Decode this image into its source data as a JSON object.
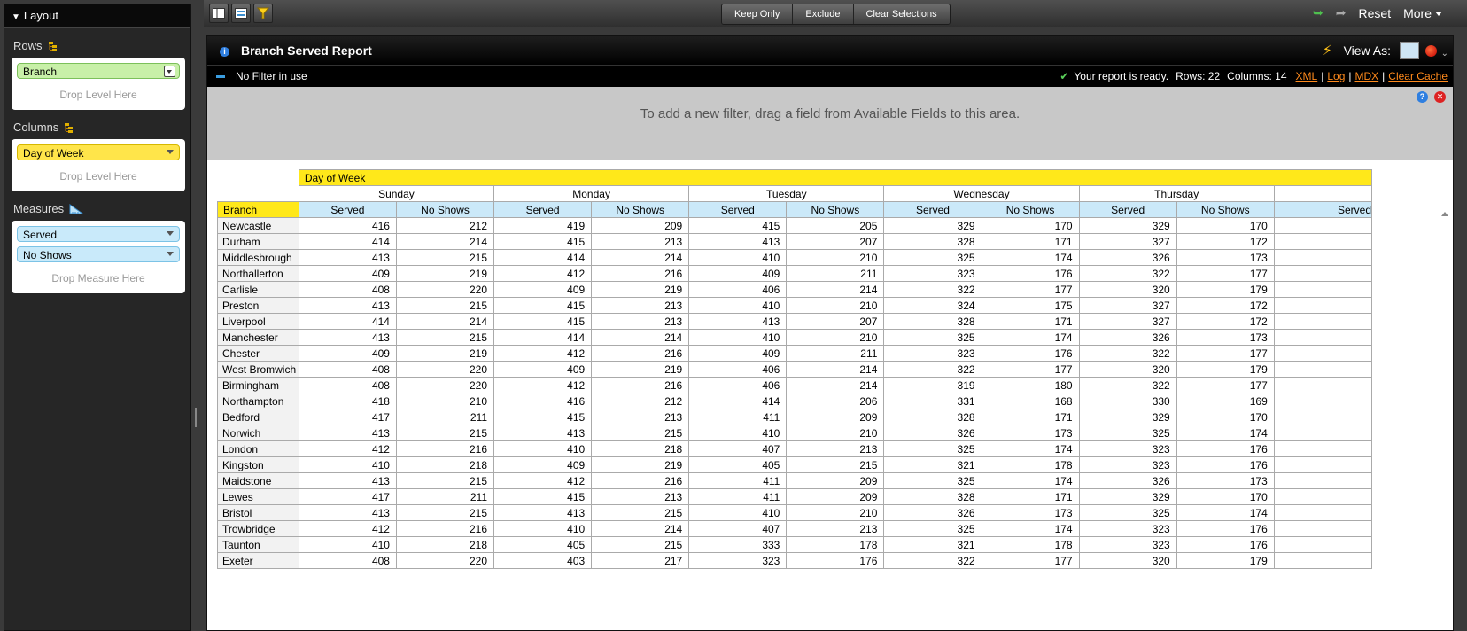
{
  "layout_panel": {
    "title": "Layout",
    "rows_label": "Rows",
    "rows_items": [
      "Branch"
    ],
    "rows_drop": "Drop Level Here",
    "columns_label": "Columns",
    "columns_items": [
      "Day of Week"
    ],
    "columns_drop": "Drop Level Here",
    "measures_label": "Measures",
    "measures_items": [
      "Served",
      "No Shows"
    ],
    "measures_drop": "Drop Measure Here"
  },
  "toolbar": {
    "keep_only": "Keep Only",
    "exclude": "Exclude",
    "clear_selections": "Clear Selections",
    "reset": "Reset",
    "more": "More"
  },
  "report": {
    "title": "Branch Served Report",
    "view_as": "View As:",
    "filter_text": "No Filter in use",
    "status_text": "Your report is ready.",
    "rows_count": "Rows: 22",
    "columns_count": "Columns: 14",
    "links": [
      "XML",
      "Log",
      "MDX",
      "Clear Cache"
    ],
    "drop_message": "To add a new filter, drag a field from Available Fields to this area."
  },
  "pivot": {
    "column_dimension": "Day of Week",
    "row_dimension": "Branch",
    "days": [
      "Sunday",
      "Monday",
      "Tuesday",
      "Wednesday",
      "Thursday"
    ],
    "measures": [
      "Served",
      "No Shows"
    ],
    "partial_measure": "Served",
    "rows": [
      {
        "branch": "Newcastle",
        "values": [
          416,
          212,
          419,
          209,
          415,
          205,
          329,
          170,
          329,
          170
        ]
      },
      {
        "branch": "Durham",
        "values": [
          414,
          214,
          415,
          213,
          413,
          207,
          328,
          171,
          327,
          172
        ]
      },
      {
        "branch": "Middlesbrough",
        "values": [
          413,
          215,
          414,
          214,
          410,
          210,
          325,
          174,
          326,
          173
        ]
      },
      {
        "branch": "Northallerton",
        "values": [
          409,
          219,
          412,
          216,
          409,
          211,
          323,
          176,
          322,
          177
        ]
      },
      {
        "branch": "Carlisle",
        "values": [
          408,
          220,
          409,
          219,
          406,
          214,
          322,
          177,
          320,
          179
        ]
      },
      {
        "branch": "Preston",
        "values": [
          413,
          215,
          415,
          213,
          410,
          210,
          324,
          175,
          327,
          172
        ]
      },
      {
        "branch": "Liverpool",
        "values": [
          414,
          214,
          415,
          213,
          413,
          207,
          328,
          171,
          327,
          172
        ]
      },
      {
        "branch": "Manchester",
        "values": [
          413,
          215,
          414,
          214,
          410,
          210,
          325,
          174,
          326,
          173
        ]
      },
      {
        "branch": "Chester",
        "values": [
          409,
          219,
          412,
          216,
          409,
          211,
          323,
          176,
          322,
          177
        ]
      },
      {
        "branch": "West Bromwich",
        "values": [
          408,
          220,
          409,
          219,
          406,
          214,
          322,
          177,
          320,
          179
        ]
      },
      {
        "branch": "Birmingham",
        "values": [
          408,
          220,
          412,
          216,
          406,
          214,
          319,
          180,
          322,
          177
        ]
      },
      {
        "branch": "Northampton",
        "values": [
          418,
          210,
          416,
          212,
          414,
          206,
          331,
          168,
          330,
          169
        ]
      },
      {
        "branch": "Bedford",
        "values": [
          417,
          211,
          415,
          213,
          411,
          209,
          328,
          171,
          329,
          170
        ]
      },
      {
        "branch": "Norwich",
        "values": [
          413,
          215,
          413,
          215,
          410,
          210,
          326,
          173,
          325,
          174
        ]
      },
      {
        "branch": "London",
        "values": [
          412,
          216,
          410,
          218,
          407,
          213,
          325,
          174,
          323,
          176
        ]
      },
      {
        "branch": "Kingston",
        "values": [
          410,
          218,
          409,
          219,
          405,
          215,
          321,
          178,
          323,
          176
        ]
      },
      {
        "branch": "Maidstone",
        "values": [
          413,
          215,
          412,
          216,
          411,
          209,
          325,
          174,
          326,
          173
        ]
      },
      {
        "branch": "Lewes",
        "values": [
          417,
          211,
          415,
          213,
          411,
          209,
          328,
          171,
          329,
          170
        ]
      },
      {
        "branch": "Bristol",
        "values": [
          413,
          215,
          413,
          215,
          410,
          210,
          326,
          173,
          325,
          174
        ]
      },
      {
        "branch": "Trowbridge",
        "values": [
          412,
          216,
          410,
          214,
          407,
          213,
          325,
          174,
          323,
          176
        ]
      },
      {
        "branch": "Taunton",
        "values": [
          410,
          218,
          405,
          215,
          333,
          178,
          321,
          178,
          323,
          176
        ]
      },
      {
        "branch": "Exeter",
        "values": [
          408,
          220,
          403,
          217,
          323,
          176,
          322,
          177,
          320,
          179
        ]
      }
    ]
  },
  "colors": {
    "accent_yellow": "#ffe81a",
    "measure_blue": "#cbe9f9",
    "rows_green": "#c8f0a8",
    "link_orange": "#ff8a1c"
  }
}
